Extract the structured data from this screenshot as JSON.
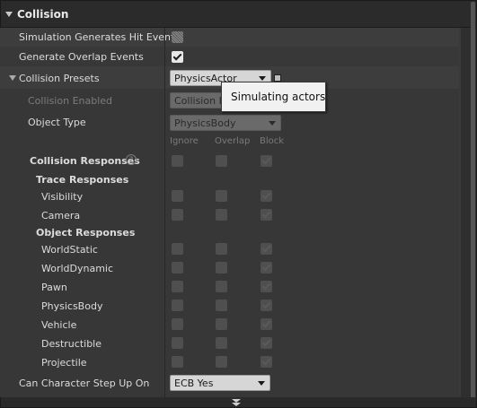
{
  "header": {
    "title": "Collision"
  },
  "rows": {
    "hit_events": {
      "label": "Simulation Generates Hit Events"
    },
    "overlap_events": {
      "label": "Generate Overlap Events"
    },
    "presets": {
      "label": "Collision Presets",
      "value": "PhysicsActor"
    },
    "collision_enabled": {
      "label": "Collision Enabled",
      "value": "Collision E"
    },
    "object_type": {
      "label": "Object Type",
      "value": "PhysicsBody"
    },
    "columns": [
      "Ignore",
      "Overlap",
      "Block"
    ],
    "collision_responses": {
      "label": "Collision Responses",
      "help": "?"
    },
    "trace_responses": {
      "label": "Trace Responses"
    },
    "object_responses": {
      "label": "Object Responses"
    },
    "trace_items": [
      "Visibility",
      "Camera"
    ],
    "object_items": [
      "WorldStatic",
      "WorldDynamic",
      "Pawn",
      "PhysicsBody",
      "Vehicle",
      "Destructible",
      "Projectile"
    ],
    "step_up": {
      "label": "Can Character Step Up On",
      "value": "ECB Yes"
    }
  },
  "tooltip": {
    "text": "Simulating actors"
  }
}
